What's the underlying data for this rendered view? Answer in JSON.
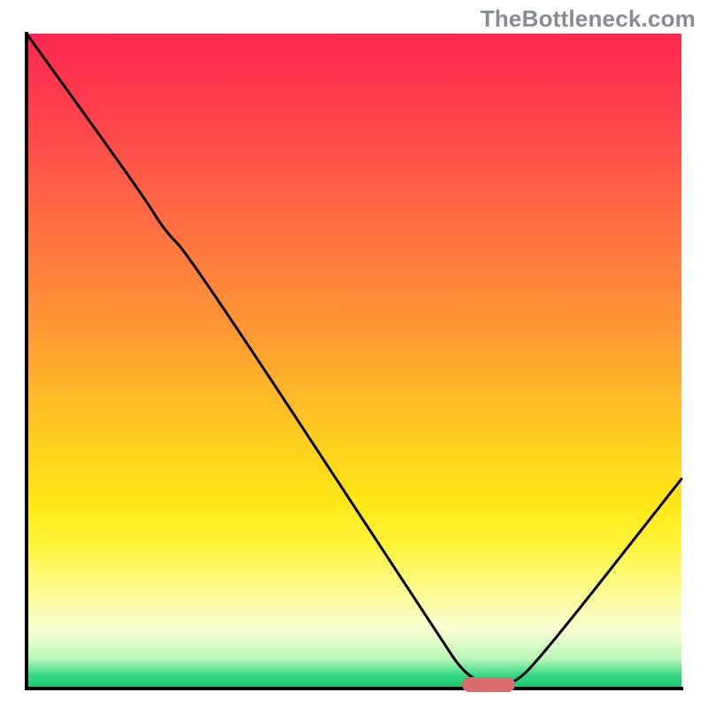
{
  "watermark": "TheBottleneck.com",
  "chart_data": {
    "type": "line",
    "title": "",
    "xlabel": "",
    "ylabel": "",
    "xlim": [
      0,
      100
    ],
    "ylim": [
      0,
      100
    ],
    "x": [
      0,
      18,
      21,
      25,
      63,
      67,
      71,
      74,
      78,
      100
    ],
    "bottleneck_pct": [
      100,
      75,
      70,
      66,
      8,
      2,
      0.5,
      0.5,
      4,
      32
    ],
    "optimum_marker": {
      "x_start": 67,
      "x_end": 74,
      "y": 0.5
    },
    "gradient_stops": [
      {
        "pct": 0,
        "color": "#ff2850"
      },
      {
        "pct": 50,
        "color": "#ffb400"
      },
      {
        "pct": 80,
        "color": "#fff24a"
      },
      {
        "pct": 100,
        "color": "#17c96e"
      }
    ]
  }
}
